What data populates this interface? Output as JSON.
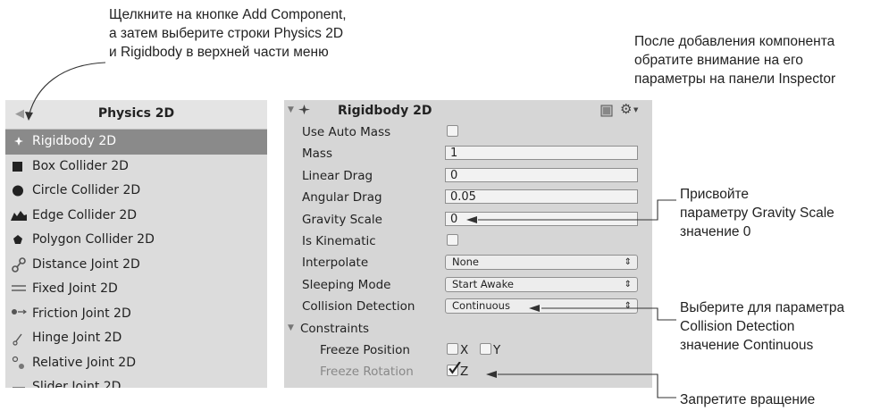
{
  "callouts": {
    "top_center": [
      "Щелкните на кнопке Add Component,",
      "а затем выберите строки Physics 2D",
      "и Rigidbody в верхней части меню"
    ],
    "top_right": [
      "После добавления компонента",
      "обратите внимание на его",
      "параметры на панели Inspector"
    ],
    "gravity": [
      "Присвойте",
      "параметру Gravity Scale",
      "значение 0"
    ],
    "collision": [
      "Выберите для параметра",
      "Collision Detection",
      "значение Continuous"
    ],
    "rotation": [
      "Запретите вращение"
    ]
  },
  "menu": {
    "back_icon": "◀",
    "title": "Physics 2D",
    "items": [
      {
        "label": "Rigidbody 2D",
        "icon": "rigidbody-icon",
        "selected": true
      },
      {
        "label": "Box Collider 2D",
        "icon": "box-collider-icon"
      },
      {
        "label": "Circle Collider 2D",
        "icon": "circle-collider-icon"
      },
      {
        "label": "Edge Collider 2D",
        "icon": "edge-collider-icon"
      },
      {
        "label": "Polygon Collider 2D",
        "icon": "polygon-collider-icon"
      },
      {
        "label": "Distance Joint 2D",
        "icon": "distance-joint-icon"
      },
      {
        "label": "Fixed Joint 2D",
        "icon": "fixed-joint-icon"
      },
      {
        "label": "Friction Joint 2D",
        "icon": "friction-joint-icon"
      },
      {
        "label": "Hinge Joint 2D",
        "icon": "hinge-joint-icon"
      },
      {
        "label": "Relative Joint 2D",
        "icon": "relative-joint-icon"
      },
      {
        "label": "Slider Joint 2D",
        "icon": "slider-joint-icon"
      }
    ]
  },
  "inspector": {
    "title": "Rigidbody 2D",
    "fields": {
      "use_auto_mass": {
        "label": "Use Auto Mass",
        "checked": false
      },
      "mass": {
        "label": "Mass",
        "value": "1"
      },
      "linear_drag": {
        "label": "Linear Drag",
        "value": "0"
      },
      "angular_drag": {
        "label": "Angular Drag",
        "value": "0.05"
      },
      "gravity_scale": {
        "label": "Gravity Scale",
        "value": "0"
      },
      "is_kinematic": {
        "label": "Is Kinematic",
        "checked": false
      },
      "interpolate": {
        "label": "Interpolate",
        "value": "None"
      },
      "sleeping_mode": {
        "label": "Sleeping Mode",
        "value": "Start Awake"
      },
      "collision_detection": {
        "label": "Collision Detection",
        "value": "Continuous"
      }
    },
    "constraints": {
      "label": "Constraints",
      "freeze_position": {
        "label": "Freeze Position",
        "x": "X",
        "y": "Y"
      },
      "freeze_rotation": {
        "label": "Freeze Rotation",
        "z": "Z"
      }
    }
  }
}
